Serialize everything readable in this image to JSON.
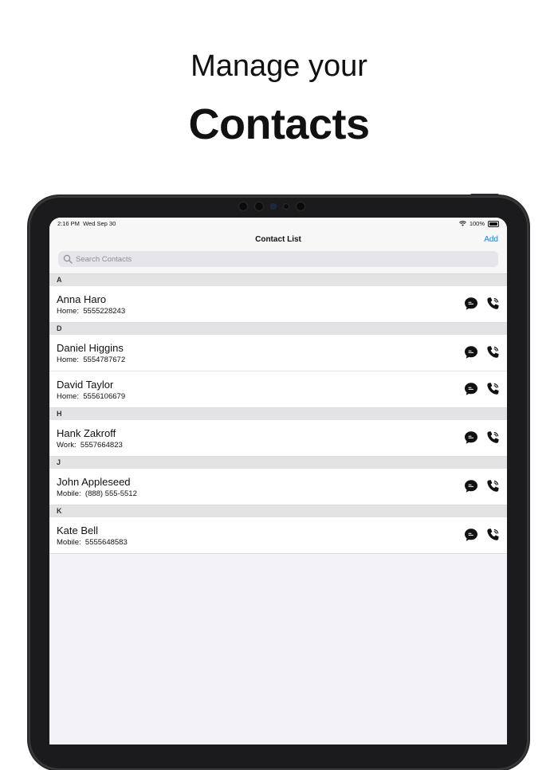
{
  "promo": {
    "line1": "Manage your",
    "line2": "Contacts"
  },
  "status_bar": {
    "time": "2:16 PM",
    "date": "Wed Sep 30",
    "battery": "100%"
  },
  "nav": {
    "title": "Contact List",
    "add_label": "Add"
  },
  "search": {
    "placeholder": "Search Contacts",
    "value": ""
  },
  "icons": {
    "message": "message-bubble-icon",
    "call": "phone-call-icon",
    "search": "search-icon"
  },
  "colors": {
    "accent": "#0a84ff",
    "section_bg": "#e3e3e6",
    "screen_bg": "#f2f2f7"
  },
  "sections": [
    {
      "letter": "A",
      "contacts": [
        {
          "name": "Anna Haro",
          "phone_label": "Home:",
          "phone": "5555228243"
        }
      ]
    },
    {
      "letter": "D",
      "contacts": [
        {
          "name": "Daniel Higgins",
          "phone_label": "Home:",
          "phone": "5554787672"
        },
        {
          "name": "David Taylor",
          "phone_label": "Home:",
          "phone": "5556106679"
        }
      ]
    },
    {
      "letter": "H",
      "contacts": [
        {
          "name": "Hank Zakroff",
          "phone_label": "Work:",
          "phone": "5557664823"
        }
      ]
    },
    {
      "letter": "J",
      "contacts": [
        {
          "name": "John Appleseed",
          "phone_label": "Mobile:",
          "phone": "(888) 555-5512"
        }
      ]
    },
    {
      "letter": "K",
      "contacts": [
        {
          "name": "Kate Bell",
          "phone_label": "Mobile:",
          "phone": "5555648583"
        }
      ]
    }
  ]
}
